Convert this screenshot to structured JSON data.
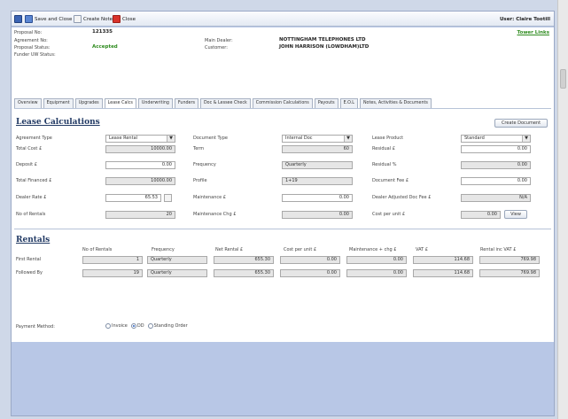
{
  "toolbar": {
    "save_close": "Save and Close",
    "create_note": "Create Note",
    "close": "Close",
    "user": "User: Claire Tootill"
  },
  "header": {
    "proposal_no_label": "Proposal No:",
    "proposal_no": "121335",
    "agreement_no_label": "Agreement No:",
    "proposal_status_label": "Proposal Status:",
    "proposal_status": "Accepted",
    "funder_uw_label": "Funder UW Status:",
    "main_dealer_label": "Main Dealer:",
    "main_dealer": "NOTTINGHAM TELEPHONES LTD",
    "customer_label": "Customer:",
    "customer": "JOHN HARRISON (LOWDHAM)LTD",
    "tower_links": "Tower Links"
  },
  "tabs": [
    "Overview",
    "Equipment",
    "Upgrades",
    "Lease Calcs",
    "Underwriting",
    "Funders",
    "Doc & Lessee Check",
    "Commission Calculations",
    "Payouts",
    "E.O.L",
    "Notes, Activities & Documents"
  ],
  "lease": {
    "title": "Lease Calculations",
    "create_document": "Create Document",
    "agreement_type_label": "Agreement Type",
    "agreement_type": "Lease Rental",
    "total_cost_label": "Total Cost £",
    "total_cost": "10000.00",
    "deposit_label": "Deposit £",
    "deposit": "0.00",
    "total_financed_label": "Total Financed £",
    "total_financed": "10000.00",
    "dealer_rate_label": "Dealer Rate £",
    "dealer_rate": "65.53",
    "no_rentals_label": "No of Rentals",
    "no_rentals": "20",
    "document_type_label": "Document Type",
    "document_type": "Internal Doc",
    "term_label": "Term",
    "term": "60",
    "frequency_label": "Frequency",
    "frequency": "Quarterly",
    "profile_label": "Profile",
    "profile": "1+19",
    "maintenance_label": "Maintenance £",
    "maintenance": "0.00",
    "maintenance_chg_label": "Maintenance Chg £",
    "maintenance_chg": "0.00",
    "lease_product_label": "Lease Product",
    "lease_product": "Standard",
    "residual_label": "Residual £",
    "residual": "0.00",
    "residual_pct_label": "Residual %",
    "residual_pct": "0.00",
    "document_fee_label": "Document Fee £",
    "document_fee": "0.00",
    "dealer_adj_fee_label": "Dealer Adjusted Doc Fee £",
    "dealer_adj_fee": "N/A",
    "cost_per_unit_label": "Cost per unit £",
    "cost_per_unit": "0.00",
    "view": "View"
  },
  "rentals": {
    "title": "Rentals",
    "headers": [
      "No of Rentals",
      "Frequency",
      "Net Rental £",
      "Cost per unit £",
      "Maintenance + chg £",
      "VAT £",
      "Rental inc VAT £"
    ],
    "rows": [
      {
        "label": "First Rental",
        "no": "1",
        "freq": "Quarterly",
        "net": "655.30",
        "cpu": "0.00",
        "maint": "0.00",
        "vat": "114.68",
        "inc": "769.98"
      },
      {
        "label": "Followed By",
        "no": "19",
        "freq": "Quarterly",
        "net": "655.30",
        "cpu": "0.00",
        "maint": "0.00",
        "vat": "114.68",
        "inc": "769.98"
      }
    ]
  },
  "payment": {
    "label": "Payment Method:",
    "options": [
      "Invoice",
      "DD",
      "Standing Order"
    ],
    "selected": "DD"
  },
  "colors": {
    "accepted": "#2e8b1e",
    "tower_links": "#2e8b1e",
    "section_title": "#223a64",
    "page_bg": "#b8c7e6"
  }
}
